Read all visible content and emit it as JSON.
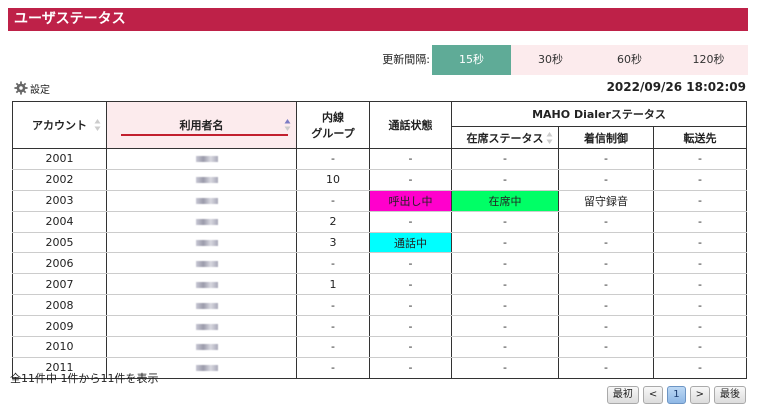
{
  "header": {
    "title": "ユーザステータス"
  },
  "refresh": {
    "label": "更新間隔:",
    "options": [
      "15秒",
      "30秒",
      "60秒",
      "120秒"
    ],
    "active_index": 0
  },
  "settings": {
    "label": "設定",
    "icon": "gear-icon"
  },
  "datetime": "2022/09/26 18:02:09",
  "table": {
    "headers": {
      "account": "アカウント",
      "user_name": "利用者名",
      "group_line1": "内線",
      "group_line2": "グループ",
      "call_status": "通話状態",
      "dialer_status": "MAHO Dialerステータス",
      "presence": "在席ステータス",
      "incoming": "着信制御",
      "forward": "転送先"
    },
    "rows": [
      {
        "account": "2001",
        "group": "-",
        "call": "-",
        "presence": "-",
        "incoming": "-",
        "forward": "-"
      },
      {
        "account": "2002",
        "group": "10",
        "call": "-",
        "presence": "-",
        "incoming": "-",
        "forward": "-"
      },
      {
        "account": "2003",
        "group": "-",
        "call": "呼出し中",
        "presence": "在席中",
        "incoming": "留守録音",
        "forward": "-"
      },
      {
        "account": "2004",
        "group": "2",
        "call": "-",
        "presence": "-",
        "incoming": "-",
        "forward": "-"
      },
      {
        "account": "2005",
        "group": "3",
        "call": "通話中",
        "presence": "-",
        "incoming": "-",
        "forward": "-"
      },
      {
        "account": "2006",
        "group": "-",
        "call": "-",
        "presence": "-",
        "incoming": "-",
        "forward": "-"
      },
      {
        "account": "2007",
        "group": "1",
        "call": "-",
        "presence": "-",
        "incoming": "-",
        "forward": "-"
      },
      {
        "account": "2008",
        "group": "-",
        "call": "-",
        "presence": "-",
        "incoming": "-",
        "forward": "-"
      },
      {
        "account": "2009",
        "group": "-",
        "call": "-",
        "presence": "-",
        "incoming": "-",
        "forward": "-"
      },
      {
        "account": "2010",
        "group": "-",
        "call": "-",
        "presence": "-",
        "incoming": "-",
        "forward": "-"
      },
      {
        "account": "2011",
        "group": "-",
        "call": "-",
        "presence": "-",
        "incoming": "-",
        "forward": "-"
      }
    ]
  },
  "footer": {
    "count_text": "全11件中 1件から11件を表示",
    "pager": {
      "first": "最初",
      "prev": "<",
      "current": "1",
      "next": ">",
      "last": "最後"
    }
  },
  "colors": {
    "header_bg": "#be2148",
    "active_interval": "#5fab97",
    "ringing": "#ff00cc",
    "present": "#00ff66",
    "talking": "#00ffff"
  }
}
